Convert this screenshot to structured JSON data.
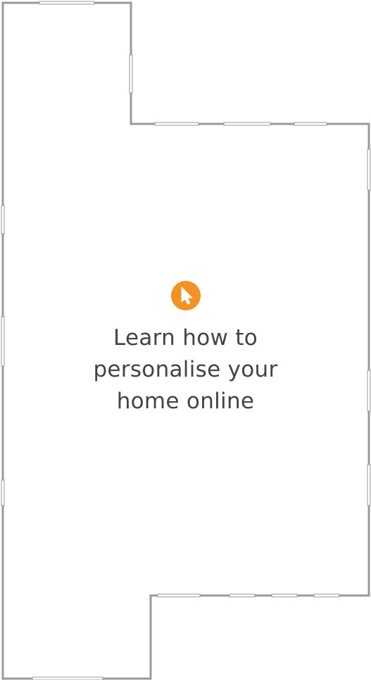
{
  "cta": {
    "icon": "cursor-click-icon",
    "lines": [
      "Learn how to",
      "personalise your",
      "home online"
    ]
  },
  "colors": {
    "accent": "#f29222",
    "wall": "#9a9a9a",
    "text": "#444444"
  }
}
